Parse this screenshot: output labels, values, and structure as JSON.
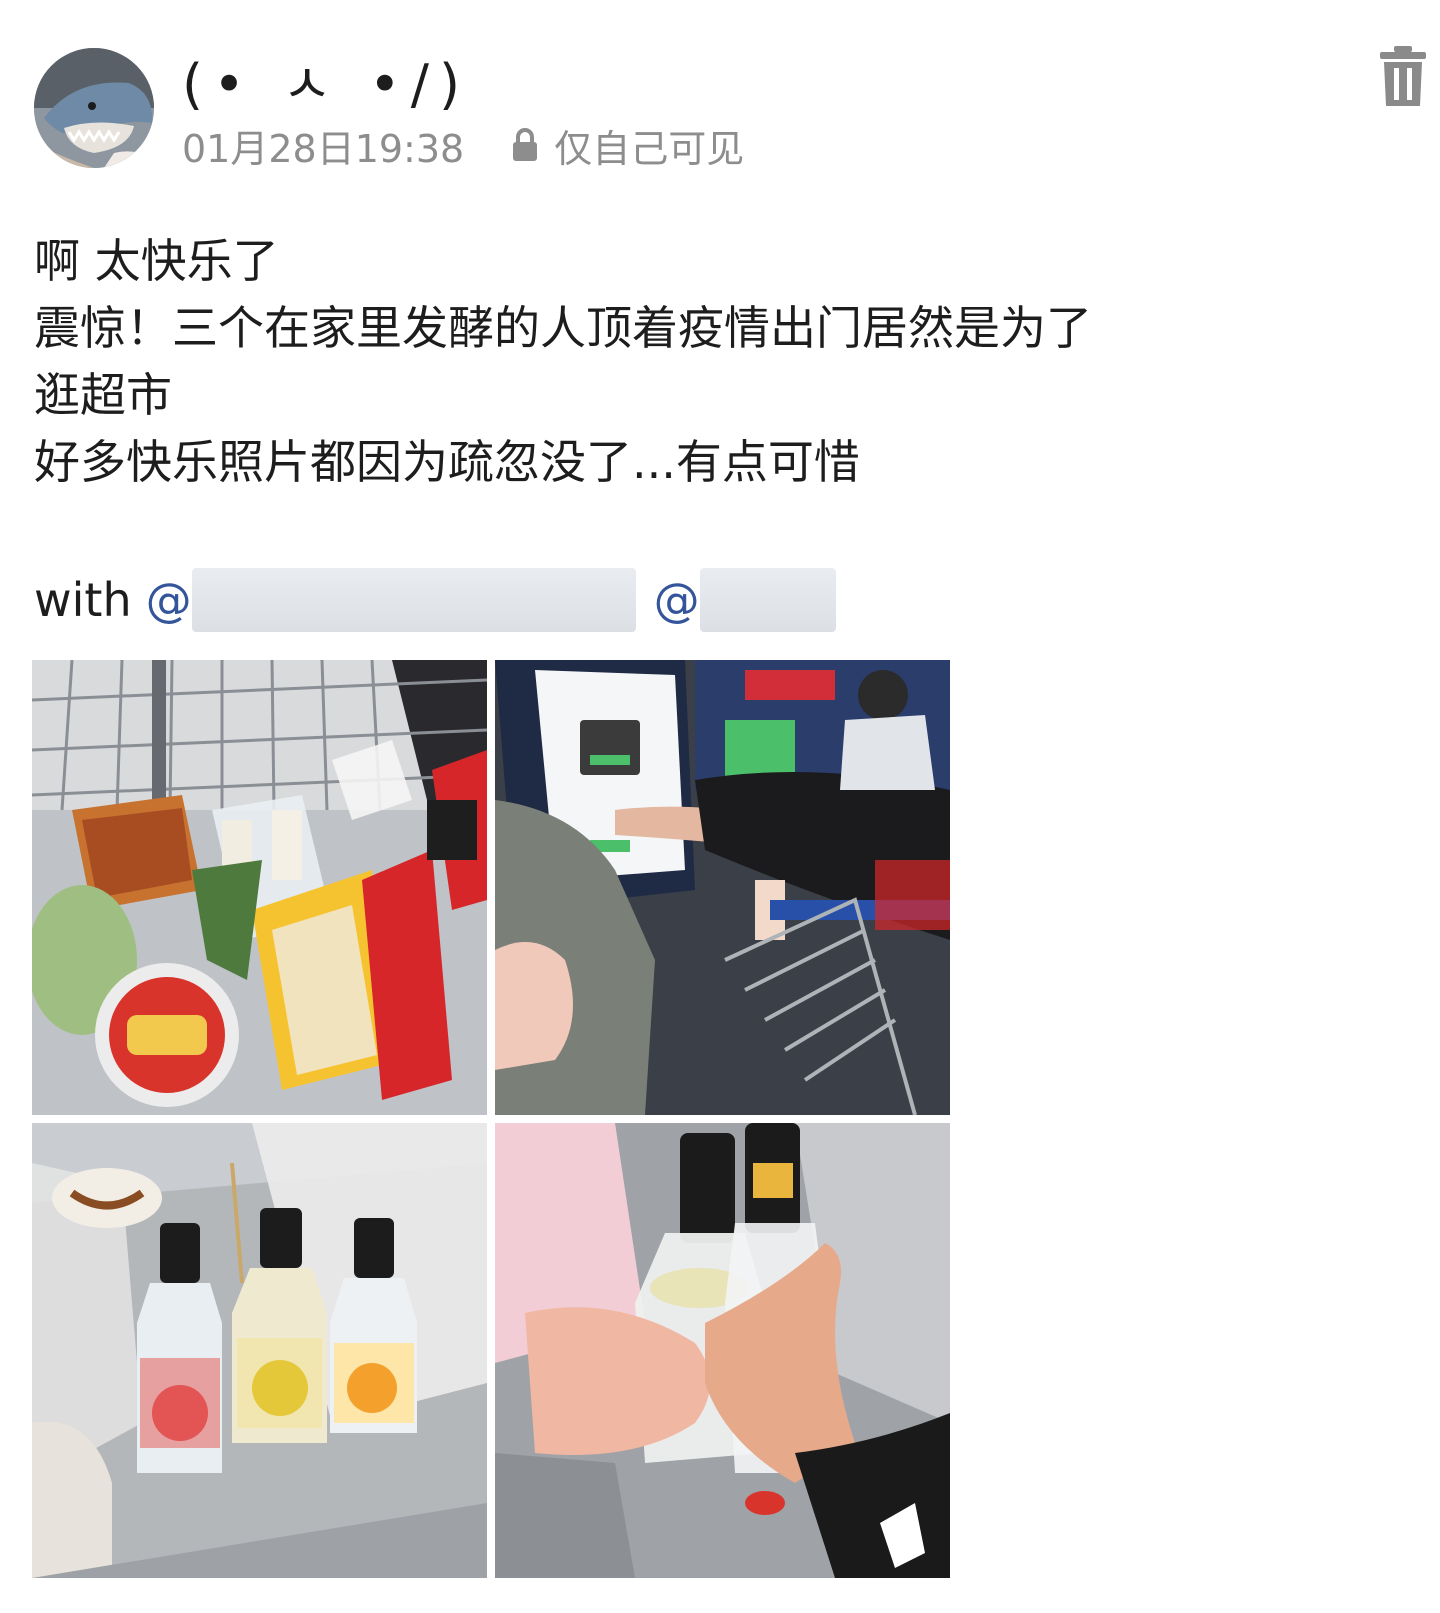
{
  "post": {
    "username": "(• ㅅ •/)",
    "time": "01月28日19:38",
    "visibility": "仅自己可见",
    "text_lines": [
      "啊 太快乐了",
      "震惊！三个在家里发酵的人顶着疫情出门居然是为了",
      "逛超市",
      "好多快乐照片都因为疏忽没了...有点可惜"
    ],
    "with_label": "with",
    "mentions": [
      "@",
      "@"
    ],
    "photos": [
      {
        "description_icon": "shopping-cart-photo"
      },
      {
        "description_icon": "self-checkout-photo"
      },
      {
        "description_icon": "rio-bottles-photo"
      },
      {
        "description_icon": "toast-photo"
      }
    ]
  },
  "icons": {
    "lock": "lock-icon",
    "delete": "trash-icon"
  },
  "colors": {
    "mention": "#35559b",
    "meta": "#8d8d8d",
    "text": "#1d1d1d"
  }
}
